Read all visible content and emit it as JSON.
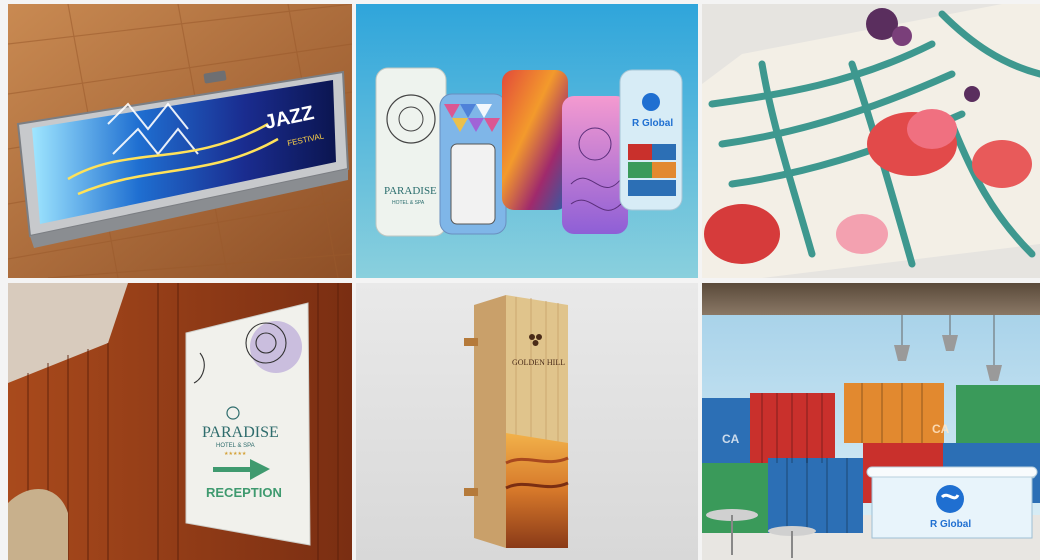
{
  "tiles": [
    {
      "name": "case-on-floor",
      "text": {
        "festival_word": "JAZZ",
        "festival_sub": "FESTIVAL"
      }
    },
    {
      "name": "phone-cases",
      "text": {
        "brand": "PARADISE",
        "brand_sub": "HOTEL & SPA",
        "logo": "R Global"
      }
    },
    {
      "name": "floral-prints",
      "text": {}
    },
    {
      "name": "wall-sign",
      "text": {
        "brand": "PARADISE",
        "brand_sub": "HOTEL & SPA",
        "stars": "★★★★★",
        "direction": "RECEPTION"
      }
    },
    {
      "name": "wooden-box",
      "text": {
        "brand": "GOLDEN HILL"
      }
    },
    {
      "name": "reception-desk",
      "text": {
        "logo": "R Global",
        "container_label": "CA"
      }
    }
  ],
  "colors": {
    "wood_floor": "#b06a38",
    "sky_blue": "#3fa9dc",
    "teal_leaf": "#2b8f86",
    "coral": "#e24a4a",
    "sign_green": "#3f9a6f",
    "container_red": "#c9302c",
    "container_blue": "#2c6fb5",
    "container_orange": "#e2892f",
    "container_green": "#3a9a5a"
  }
}
